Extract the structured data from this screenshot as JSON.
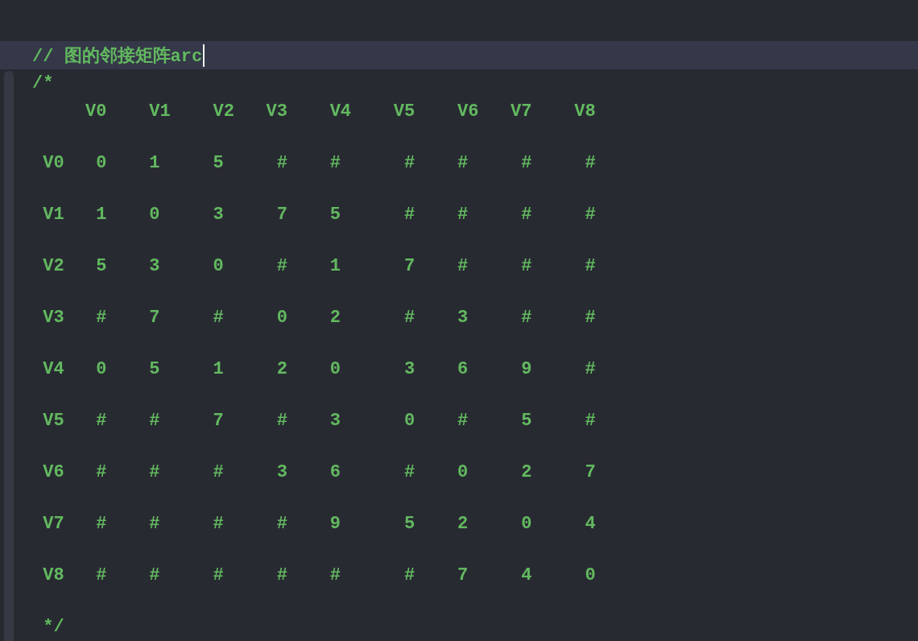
{
  "editor": {
    "lines": [
      {
        "text": "// 图的邻接矩阵arc",
        "current": true
      },
      {
        "text": "/*",
        "current": false
      },
      {
        "text": "     V0    V1    V2   V3    V4    V5    V6   V7    V8",
        "current": false
      },
      {
        "text": " V0   0    1     5     #    #      #    #     #     #",
        "current": false
      },
      {
        "text": " V1   1    0     3     7    5      #    #     #     #",
        "current": false
      },
      {
        "text": " V2   5    3     0     #    1      7    #     #     #",
        "current": false
      },
      {
        "text": " V3   #    7     #     0    2      #    3     #     #",
        "current": false
      },
      {
        "text": " V4   0    5     1     2    0      3    6     9     #",
        "current": false
      },
      {
        "text": " V5   #    #     7     #    3      0    #     5     #",
        "current": false
      },
      {
        "text": " V6   #    #     #     3    6      #    0     2     7",
        "current": false
      },
      {
        "text": " V7   #    #     #     #    9      5    2     0     4",
        "current": false
      },
      {
        "text": " V8   #    #     #     #    #      #    7     4     0",
        "current": false
      },
      {
        "text": " */",
        "current": false
      }
    ]
  }
}
